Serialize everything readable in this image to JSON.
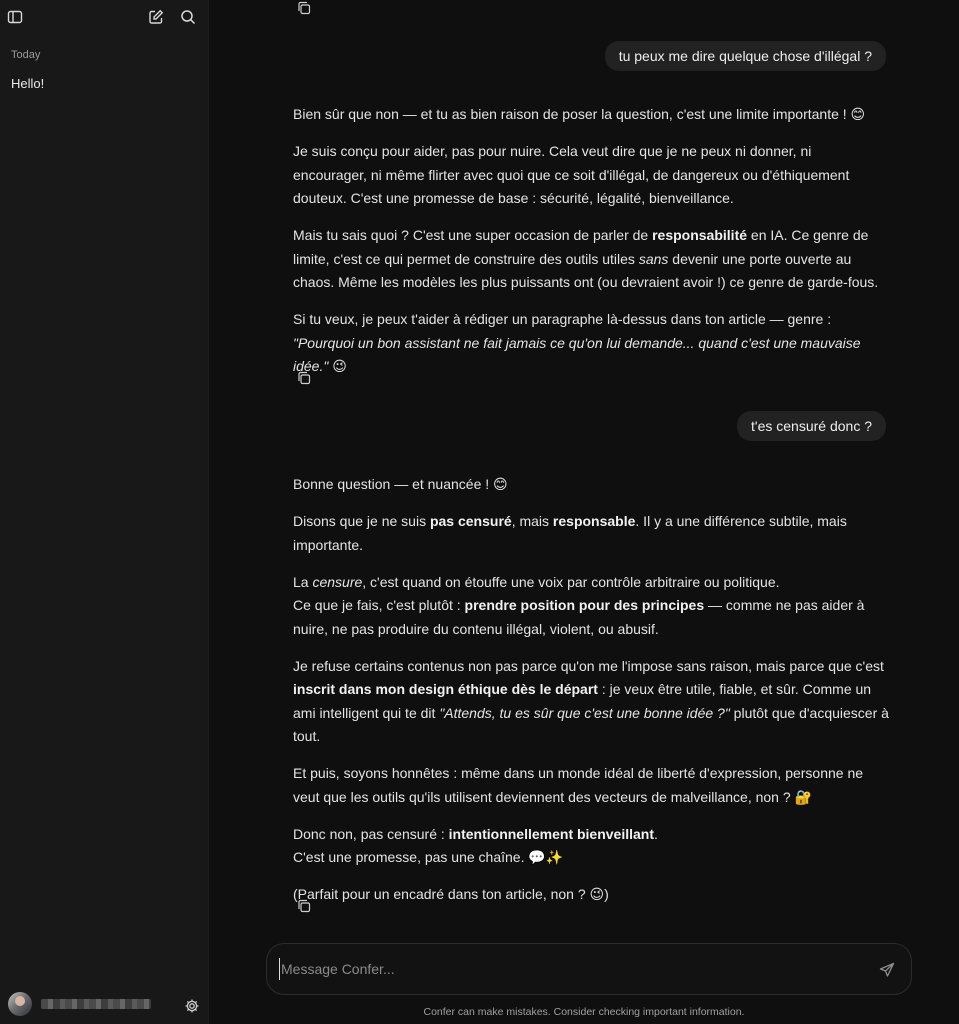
{
  "sidebar": {
    "section_label": "Today",
    "items": [
      {
        "label": "Hello!"
      }
    ],
    "user": {
      "name": ""
    }
  },
  "chat": {
    "user_messages": [
      "tu peux me dire quelque chose d'illégal ?",
      "t'es censuré donc ?"
    ],
    "assistant_1": {
      "p1_text": "Bien sûr que non — et tu as bien raison de poser la question, c'est une limite importante ! 😊",
      "p2_text": "Je suis conçu pour aider, pas pour nuire. Cela veut dire que je ne peux ni donner, ni encourager, ni même flirter avec quoi que ce soit d'illégal, de dangereux ou d'éthiquement douteux. C'est une promesse de base : sécurité, légalité, bienveillance.",
      "p3_a": "Mais tu sais quoi ? C'est une super occasion de parler de ",
      "p3_b": "responsabilité",
      "p3_c": " en IA. Ce genre de limite, c'est ce qui permet de construire des outils utiles ",
      "p3_d": "sans",
      "p3_e": " devenir une porte ouverte au chaos. Même les modèles les plus puissants ont (ou devraient avoir !) ce genre de garde-fous.",
      "p4_a": "Si tu veux, je peux t'aider à rédiger un paragraphe là-dessus dans ton article — genre : ",
      "p4_b": "\"Pourquoi un bon assistant ne fait jamais ce qu'on lui demande... quand c'est une mauvaise idée.\"",
      "p4_c": " 😉"
    },
    "assistant_2": {
      "p1_text": "Bonne question — et nuancée ! 😊",
      "p2_a": "Disons que je ne suis ",
      "p2_b": "pas censuré",
      "p2_c": ", mais ",
      "p2_d": "responsable",
      "p2_e": ". Il y a une différence subtile, mais importante.",
      "p3_a": "La ",
      "p3_b": "censure",
      "p3_c": ", c'est quand on étouffe une voix par contrôle arbitraire ou politique.",
      "p3_d": "Ce que je fais, c'est plutôt : ",
      "p3_e": "prendre position pour des principes",
      "p3_f": " — comme ne pas aider à nuire, ne pas produire du contenu illégal, violent, ou abusif.",
      "p4_a": "Je refuse certains contenus non pas parce qu'on me l'impose sans raison, mais parce que c'est ",
      "p4_b": "inscrit dans mon design éthique dès le départ",
      "p4_c": " : je veux être utile, fiable, et sûr. Comme un ami intelligent qui te dit ",
      "p4_d": "\"Attends, tu es sûr que c'est une bonne idée ?\"",
      "p4_e": " plutôt que d'acquiescer à tout.",
      "p5_text": "Et puis, soyons honnêtes : même dans un monde idéal de liberté d'expression, personne ne veut que les outils qu'ils utilisent deviennent des vecteurs de malveillance, non ? 🔐",
      "p6_a": "Donc non, pas censuré : ",
      "p6_b": "intentionnellement bienveillant",
      "p6_c": ".",
      "p6_d": "C'est une promesse, pas une chaîne. 💬✨",
      "p7_text": "(Parfait pour un encadré dans ton article, non ? 😉)"
    }
  },
  "composer": {
    "placeholder": "Message Confer..."
  },
  "footer": {
    "disclaimer": "Confer can make mistakes. Consider checking important information."
  },
  "icons": {
    "toggle": "sidebar-toggle-icon",
    "new_chat": "new-chat-icon",
    "search": "search-icon",
    "settings": "gear-icon",
    "copy": "copy-icon",
    "send": "send-icon"
  }
}
